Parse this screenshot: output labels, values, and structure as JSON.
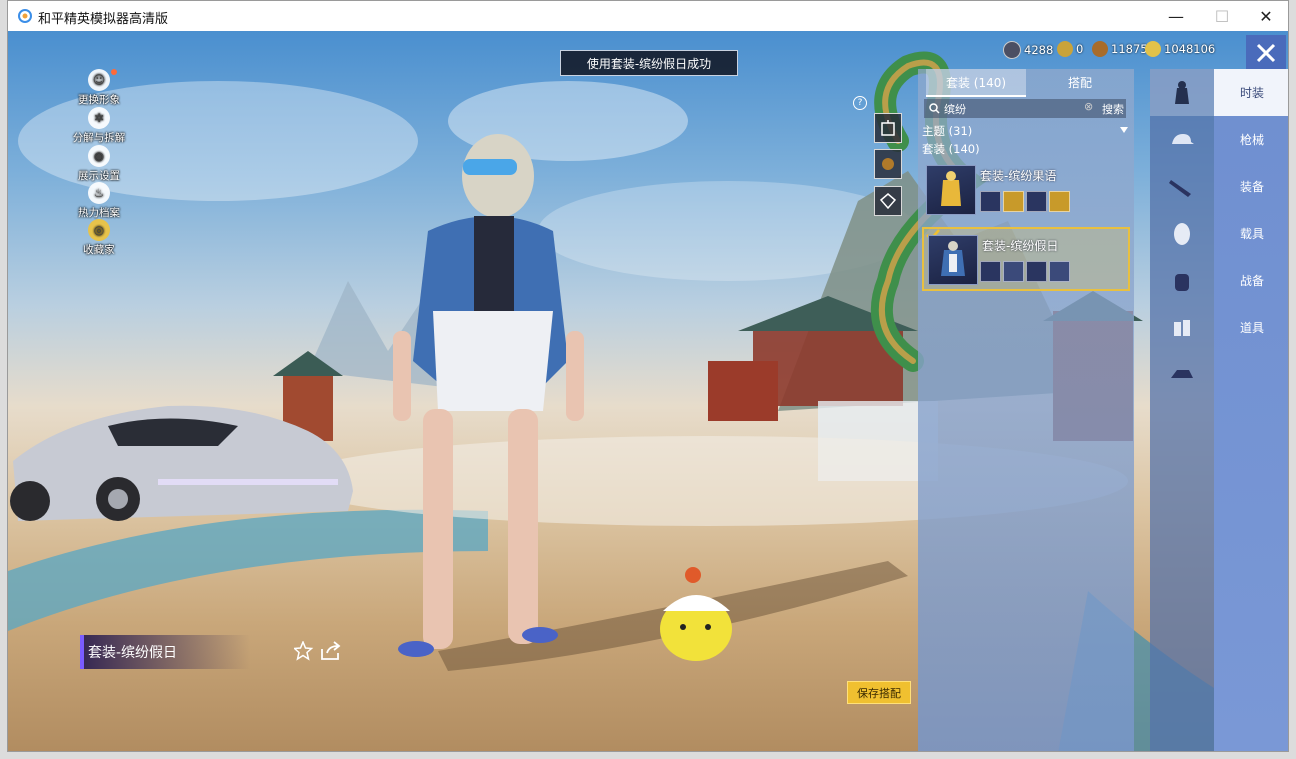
{
  "window": {
    "title": "和平精英模拟器高清版",
    "minimize": "—",
    "maximize": "☐",
    "close": "✕"
  },
  "left_menu": [
    {
      "label": "更换形象",
      "icon": "avatar-icon"
    },
    {
      "label": "分解与拆解",
      "icon": "gear-icon"
    },
    {
      "label": "展示设置",
      "icon": "eye-icon"
    },
    {
      "label": "热力档案",
      "icon": "flame-icon"
    },
    {
      "label": "收藏家",
      "icon": "medal-icon"
    }
  ],
  "toast": "使用套装-缤纷假日成功",
  "currency": [
    {
      "value": "4288",
      "color": "#4b4f63"
    },
    {
      "value": "0",
      "color": "#c9a33a"
    },
    {
      "value": "11875",
      "color": "#a86c2a"
    },
    {
      "value": "1048106",
      "color": "#e2c24a"
    }
  ],
  "help_label": "?",
  "panel": {
    "tabs": [
      {
        "label": "套装 (140)",
        "active": true
      },
      {
        "label": "搭配",
        "active": false
      }
    ],
    "search": {
      "value": "缤纷",
      "button": "搜索",
      "clear": "⊗"
    },
    "theme_label": "主题 (31)",
    "suits_label": "套装 (140)",
    "outfits": [
      {
        "name": "套装-缤纷果语",
        "selected": false
      },
      {
        "name": "套装-缤纷假日",
        "selected": true
      }
    ]
  },
  "categories": [
    {
      "label": "时装",
      "active": true
    },
    {
      "label": "枪械",
      "active": false
    },
    {
      "label": "装备",
      "active": false
    },
    {
      "label": "载具",
      "active": false
    },
    {
      "label": "战备",
      "active": false
    },
    {
      "label": "道具",
      "active": false
    }
  ],
  "selected_outfit_name": "套装-缤纷假日",
  "save_button": "保存搭配",
  "colors": {
    "accent": "#f0c030",
    "panel_blue": "#6f8fd0",
    "purple": "#7a5cff"
  }
}
